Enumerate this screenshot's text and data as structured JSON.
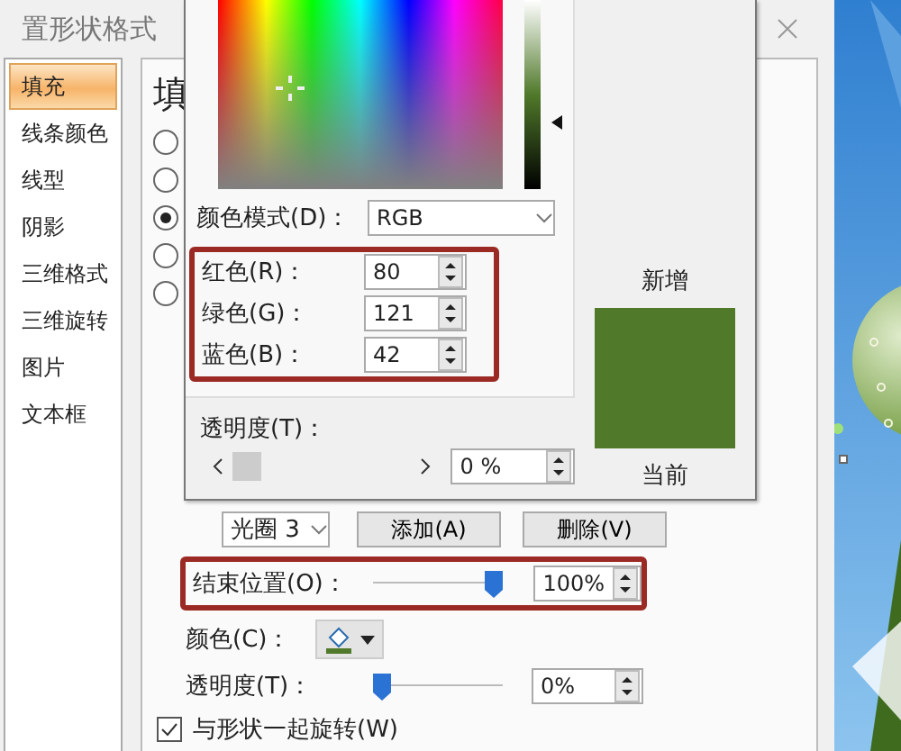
{
  "dialog": {
    "title": "置形状格式"
  },
  "sidebar": {
    "items": [
      {
        "label": "填充",
        "selected": true
      },
      {
        "label": "线条颜色",
        "selected": false
      },
      {
        "label": "线型",
        "selected": false
      },
      {
        "label": "阴影",
        "selected": false
      },
      {
        "label": "三维格式",
        "selected": false
      },
      {
        "label": "三维旋转",
        "selected": false
      },
      {
        "label": "图片",
        "selected": false
      },
      {
        "label": "文本框",
        "selected": false
      }
    ]
  },
  "fill": {
    "heading": "填",
    "options": [
      {
        "selected": false
      },
      {
        "selected": false
      },
      {
        "selected": true
      },
      {
        "selected": false
      },
      {
        "selected": false
      }
    ],
    "gradient": {
      "stop": "光圈 3",
      "add": "添加(A)",
      "remove": "删除(V)",
      "end_position": {
        "label": "结束位置(O)：",
        "level": 1,
        "value": "100%"
      },
      "color": {
        "label": "颜色(C)："
      },
      "transparency": {
        "label": "透明度(T)：",
        "level": 0,
        "value": "0%"
      },
      "rotate_with_shape": {
        "label": "与形状一起旋转(W)",
        "checked": true
      }
    }
  },
  "color_picker": {
    "mode": {
      "label": "颜色模式(D)：",
      "value": "RGB"
    },
    "channels": [
      {
        "label": "红色(R)：",
        "value": "80"
      },
      {
        "label": "绿色(G)：",
        "value": "121"
      },
      {
        "label": "蓝色(B)：",
        "value": "42"
      }
    ],
    "new_label": "新增",
    "current_label": "当前",
    "transparency": {
      "label": "透明度(T)：",
      "value": "0 %"
    }
  }
}
